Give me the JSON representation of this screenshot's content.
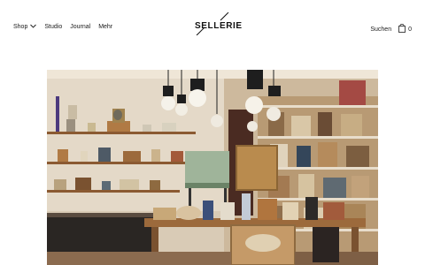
{
  "header": {
    "brand": "SELLERIE",
    "nav": [
      {
        "label": "Shop",
        "has_dropdown": true
      },
      {
        "label": "Studio"
      },
      {
        "label": "Journal"
      },
      {
        "label": "Mehr"
      }
    ],
    "search_label": "Suchen",
    "cart_count": "0"
  },
  "hero": {
    "image_icon": "store-interior-photo-icon"
  },
  "colors": {
    "background": "#ffffff",
    "text": "#1a1a1a"
  }
}
